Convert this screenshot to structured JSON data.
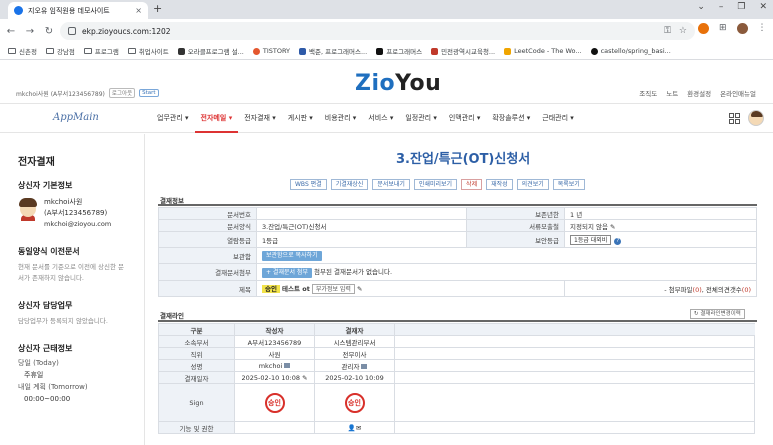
{
  "browser": {
    "tab_title": "지오유 임직원용 데모사이트",
    "tab_close": "×",
    "new_tab": "+",
    "url": "ekp.zioyoucs.com:1202",
    "window_controls": [
      "⌄",
      "–",
      "❐",
      "✕"
    ],
    "nav": {
      "back": "←",
      "forward": "→",
      "reload": "↻"
    },
    "omnibox_icons": [
      "⚿",
      "☆"
    ],
    "extension_icons": [
      "⊞",
      "⋮"
    ],
    "bookmarks": [
      {
        "label": "신촌정",
        "icon": "folder"
      },
      {
        "label": "강남점",
        "icon": "folder"
      },
      {
        "label": "프로그램",
        "icon": "folder"
      },
      {
        "label": "취업사이트",
        "icon": "folder"
      },
      {
        "label": "오라클프로그램 설...",
        "icon": "page",
        "color": "#333333"
      },
      {
        "label": "TISTORY",
        "icon": "dot",
        "color": "#e4572e"
      },
      {
        "label": "백준, 프로그래머스...",
        "icon": "dot",
        "color": "#2e5aa8"
      },
      {
        "label": "프로그래머스",
        "icon": "dot",
        "color": "#111111"
      },
      {
        "label": "민전광역시교육청...",
        "icon": "dot",
        "color": "#c0392b"
      },
      {
        "label": "LeetCode - The Wo...",
        "icon": "dot",
        "color": "#f0a500"
      },
      {
        "label": "castello/spring_basi...",
        "icon": "dot",
        "color": "#111111"
      }
    ]
  },
  "header": {
    "user_text": "mkchoi사원 (A부서123456789)",
    "chip_logout": "로그아웃",
    "chip_start": "Start",
    "logo_part1": "Zio",
    "logo_part2": "You",
    "links": [
      "조직도",
      "노트",
      "환경설정",
      "온라인매뉴얼"
    ]
  },
  "nav": {
    "app_title": "AppMain",
    "menu": [
      {
        "label": "업무관리 ▾",
        "active": false
      },
      {
        "label": "전자메일 ▾",
        "active": true
      },
      {
        "label": "전자결재 ▾",
        "active": false
      },
      {
        "label": "게시판 ▾",
        "active": false
      },
      {
        "label": "비용관리 ▾",
        "active": false
      },
      {
        "label": "서비스 ▾",
        "active": false
      },
      {
        "label": "일정관리 ▾",
        "active": false
      },
      {
        "label": "인맥관리 ▾",
        "active": false
      },
      {
        "label": "확장솔루션 ▾",
        "active": false
      },
      {
        "label": "근태관리 ▾",
        "active": false
      }
    ]
  },
  "sidebar": {
    "title": "전자결재",
    "drafter_heading": "상신자 기본정보",
    "drafter_name": "mkchoi사원",
    "drafter_dept": "(A부서123456789)",
    "drafter_email": "mkchoi@zioyou.com",
    "same_doc_heading": "동일양식 이전문서",
    "same_doc_text": "현재 문서를 기준으로 이전에 상신한 문서가 존재하지 않습니다.",
    "duty_heading": "상신자 담당업무",
    "duty_text": "담당업무가 등록되지 않았습니다.",
    "attendance_heading": "상신자 근태정보",
    "today_label": "당일 (Today)",
    "today_value": "주휴일",
    "tomorrow_label": "내일 계획 (Tomorrow)",
    "tomorrow_value": "00:00~00:00"
  },
  "document": {
    "title": "3.잔업/특근(OT)신청서",
    "buttons": [
      {
        "label": "WBS 편결",
        "color": "blue"
      },
      {
        "label": "기결재상신",
        "color": "blue"
      },
      {
        "label": "문서보내기",
        "color": "blue"
      },
      {
        "label": "인쇄미리보기",
        "color": "blue"
      },
      {
        "label": "삭제",
        "color": "red"
      },
      {
        "label": "재작성",
        "color": "blue"
      },
      {
        "label": "의견보기",
        "color": "blue"
      },
      {
        "label": "목록보기",
        "color": "blue"
      }
    ],
    "section_info": "결재정보",
    "doc_no_label": "문서번호",
    "doc_no_value": "",
    "retention_label": "보존년한",
    "retention_value": "1 년",
    "form_label": "문서양식",
    "form_value": "3.잔업/특근(OT)신청서",
    "public_label": "서류모출철",
    "public_value": "지정되지 않음",
    "access_label": "열람등급",
    "access_value": "1등급",
    "security_label": "보안등급",
    "security_value": "1등급 대외비",
    "security_help": "?",
    "storage_label": "보관함",
    "storage_button": "보관함으로 복사하기",
    "attach_label": "결재문서첨부",
    "attach_button": "+ 결재문서 첨부",
    "attach_text": "첨부된 결재문서가 없습니다.",
    "subject_label": "제목",
    "subject_badge": "승인",
    "subject_text": "테스트 ot",
    "extra_info_input": "부가정보 입력",
    "attach_files_label": "- 첨부파일",
    "attach_files_count": "(0)",
    "all_comments_label": ", 전체의견갯수",
    "all_comments_count": "(0)",
    "section_line": "결재라인",
    "history_button": "결재라인변경이력",
    "approval": {
      "headers": [
        "구분",
        "작성자",
        "결재자"
      ],
      "dept_label": "소속부서",
      "dept": [
        "A부서123456789",
        "시스템관리부서"
      ],
      "position_label": "직위",
      "position": [
        "사원",
        "전무이사"
      ],
      "name_label": "성명",
      "name": [
        "mkchoi",
        "관리자"
      ],
      "date_label": "결재일자",
      "date": [
        "2025-02-10 10:08",
        "2025-02-10 10:09"
      ],
      "sign_label": "Sign",
      "stamp": [
        "승인",
        "승인"
      ],
      "func_label": "기능 및 권한"
    }
  }
}
